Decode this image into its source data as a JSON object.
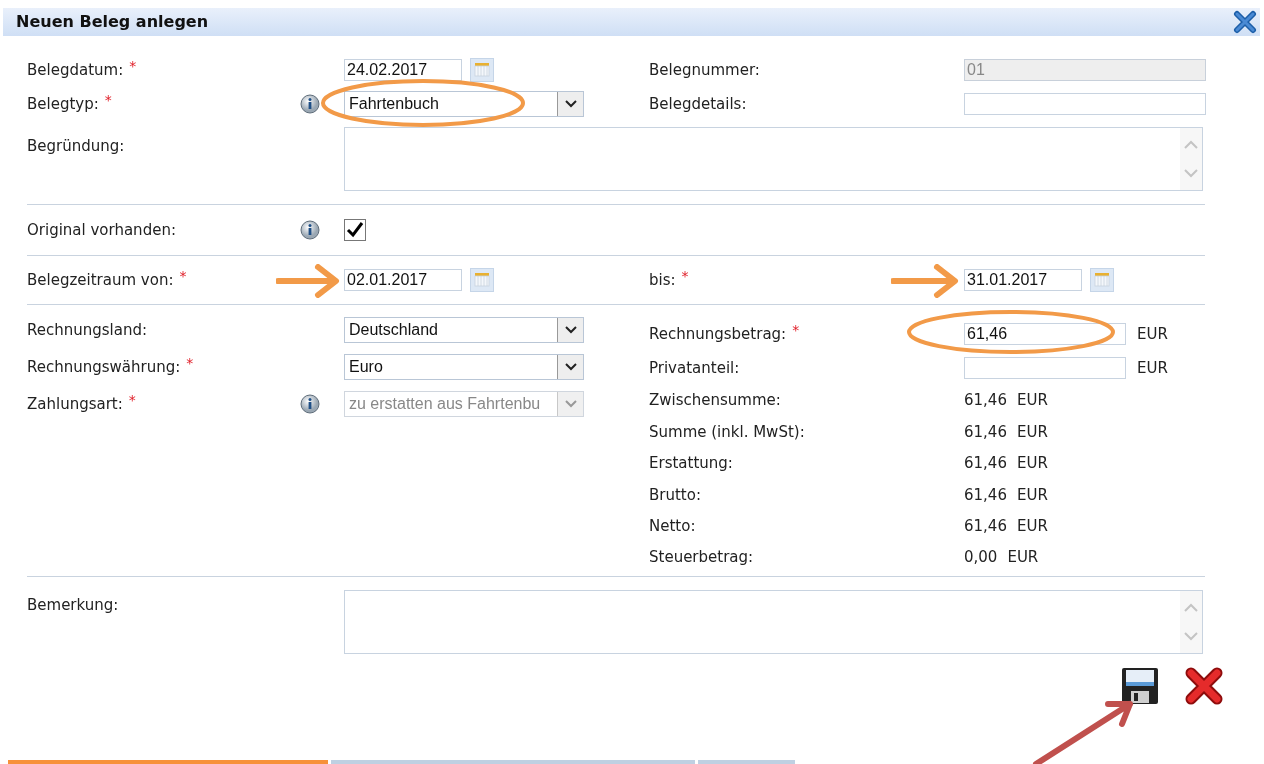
{
  "dialog": {
    "title": "Neuen Beleg anlegen"
  },
  "top_rows": [
    {
      "left": {
        "label": "Belegdatum:",
        "required": "*",
        "info": false,
        "field": {
          "kind": "date",
          "value": "24.02.2017"
        }
      },
      "right": {
        "label": "Belegnummer:",
        "field": {
          "kind": "text",
          "value": "01",
          "disabled": true
        }
      }
    },
    {
      "left": {
        "label": "Belegtyp:",
        "required": "*",
        "info": true,
        "field": {
          "kind": "select",
          "value": "Fahrtenbuch",
          "disabled": false
        }
      },
      "right": {
        "label": "Belegdetails:",
        "field": {
          "kind": "text",
          "disabled": false
        }
      }
    }
  ],
  "begruendung": {
    "label": "Begründung:"
  },
  "original": {
    "label": "Original vorhanden:",
    "info": true,
    "checked": true
  },
  "period": {
    "from": {
      "label": "Belegzeitraum von:",
      "required": "*",
      "value": "02.01.2017"
    },
    "to": {
      "label": "bis:",
      "required": "*",
      "value": "31.01.2017"
    }
  },
  "billing_left": [
    {
      "label": "Rechnungsland:",
      "info": false,
      "value": "Deutschland",
      "disabled": false
    },
    {
      "label": "Rechnungswährung:",
      "required": "*",
      "info": false,
      "value": "Euro",
      "disabled": false
    },
    {
      "label": "Zahlungsart:",
      "required": "*",
      "info": true,
      "value": "zu erstatten aus Fahrtenbu",
      "disabled": true
    }
  ],
  "billing_right": [
    {
      "kind": "input",
      "label": "Rechnungsbetrag:",
      "required": "*",
      "value": "61,46",
      "unit": "EUR"
    },
    {
      "kind": "input",
      "label": "Privatanteil:",
      "unit": "EUR"
    },
    {
      "kind": "amount",
      "label": "Zwischensumme:",
      "value": "61,46",
      "unit": "EUR"
    },
    {
      "kind": "amount",
      "label": "Summe (inkl. MwSt):",
      "value": "61,46",
      "unit": "EUR"
    },
    {
      "kind": "amount",
      "label": "Erstattung:",
      "value": "61,46",
      "unit": "EUR"
    },
    {
      "kind": "amount",
      "label": "Brutto:",
      "value": "61,46",
      "unit": "EUR"
    },
    {
      "kind": "amount",
      "label": "Netto:",
      "value": "61,46",
      "unit": "EUR"
    },
    {
      "kind": "amount",
      "label": "Steuerbetrag:",
      "value": "0,00",
      "unit": "EUR"
    }
  ],
  "bemerkung": {
    "label": "Bemerkung:"
  },
  "bottom_tabs": [
    {
      "selected": true
    },
    {
      "selected": false
    },
    {
      "selected": false
    }
  ]
}
